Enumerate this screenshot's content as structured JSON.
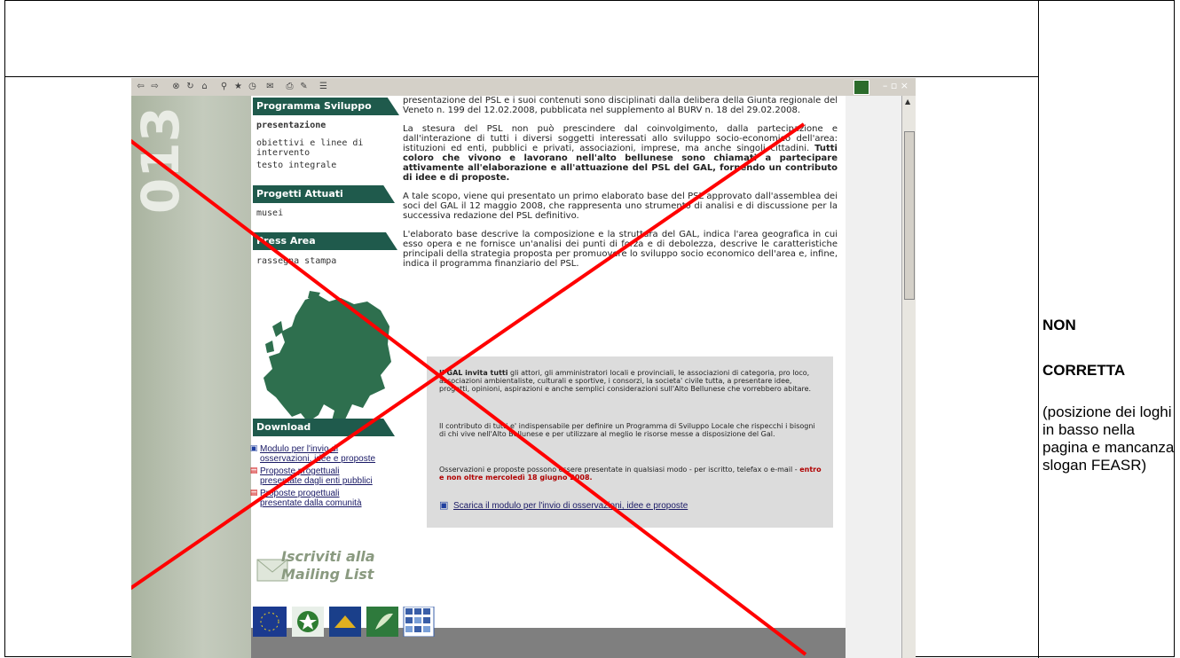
{
  "browser": {
    "toolbar_icons": [
      "back-icon",
      "forward-icon",
      "stop-icon",
      "refresh-icon",
      "home-icon",
      "search-icon",
      "favorites-icon",
      "history-icon",
      "mail-icon",
      "print-icon",
      "edit-icon",
      "discuss-icon"
    ],
    "window_controls": "– ▫ ×"
  },
  "decor": {
    "big_number": "013"
  },
  "sidebar": {
    "section_programma": "Programma Sviluppo Locale",
    "items_programma": [
      "presentazione",
      "obiettivi e linee di",
      "intervento",
      "testo integrale"
    ],
    "section_progetti": "Progetti Attuati",
    "items_progetti": [
      "musei"
    ],
    "section_press": "Press Area",
    "items_press": [
      "rassegna stampa"
    ],
    "section_download": "Download",
    "downloads": [
      {
        "line1": "Modulo per l'invio di",
        "line2": "osservazioni, idee e proposte",
        "icon": "word-doc-icon"
      },
      {
        "line1": "Proposte progettuali",
        "line2": "presentate dagli enti pubblici",
        "icon": "pdf-icon"
      },
      {
        "line1": "Proposte progettuali",
        "line2": "presentate dalla comunità",
        "icon": "pdf-icon"
      }
    ],
    "mailing_line1": "Iscriviti alla",
    "mailing_line2": "Mailing List"
  },
  "content": {
    "p1": "presentazione del PSL e i suoi contenuti sono disciplinati dalla delibera della Giunta regionale del Veneto n. 199 del 12.02.2008, pubblicata nel supplemento al BURV n. 18 del 29.02.2008.",
    "p2_normal": "La stesura del PSL non può prescindere dal coinvolgimento, dalla partecipazione e dall'interazione di tutti i diversi soggetti interessati allo sviluppo socio-economico dell'area: istituzioni ed enti, pubblici e privati, associazioni, imprese, ma anche singoli cittadini.",
    "p2_bold": "Tutti coloro che vivono e lavorano nell'alto bellunese sono chiamati a partecipare attivamente all'elaborazione e all'attuazione del PSL del GAL, fornendo un contributo di idee e di proposte.",
    "p3": "A tale scopo, viene qui presentato un primo elaborato base del PSL approvato dall'assemblea dei soci del GAL il 12 maggio 2008, che rappresenta uno strumento di analisi e di discussione per la successiva redazione del PSL definitivo.",
    "p4": "L'elaborato base descrive la composizione e la struttura del GAL, indica l'area geografica in cui esso opera e ne fornisce un'analisi dei punti di forza e di debolezza, descrive le caratteristiche principali della strategia proposta per promuovere lo sviluppo socio economico dell'area e, infine, indica il programma finanziario del PSL.",
    "box_p1_bold": "Il GAL invita tutti",
    "box_p1": "gli attori, gli amministratori locali e provinciali, le associazioni di categoria, pro loco, associazioni ambientaliste, culturali e sportive, i consorzi, la societa' civile tutta, a presentare idee, progetti, opinioni, aspirazioni e anche semplici considerazioni sull'Alto Bellunese che vorrebbero abitare.",
    "box_p2": "Il contributo di tutti e' indispensabile per definire un Programma di Sviluppo Locale che rispecchi i bisogni di chi vive nell'Alto Bellunese e per utilizzare al meglio le risorse messe a disposizione del Gal.",
    "box_p3": "Osservazioni e proposte possono essere presentate in qualsiasi modo - per iscritto, telefax o e-mail -",
    "box_p3_red": "entro e non oltre mercoledì 18 giugno 2008.",
    "box_link": "Scarica il modulo per l'invio di osservazioni, idee e proposte"
  },
  "annotation": {
    "line1": "NON",
    "line2": "CORRETTA",
    "description": "(posizione dei loghi in basso nella pagina e mancanza slogan FEASR)"
  }
}
